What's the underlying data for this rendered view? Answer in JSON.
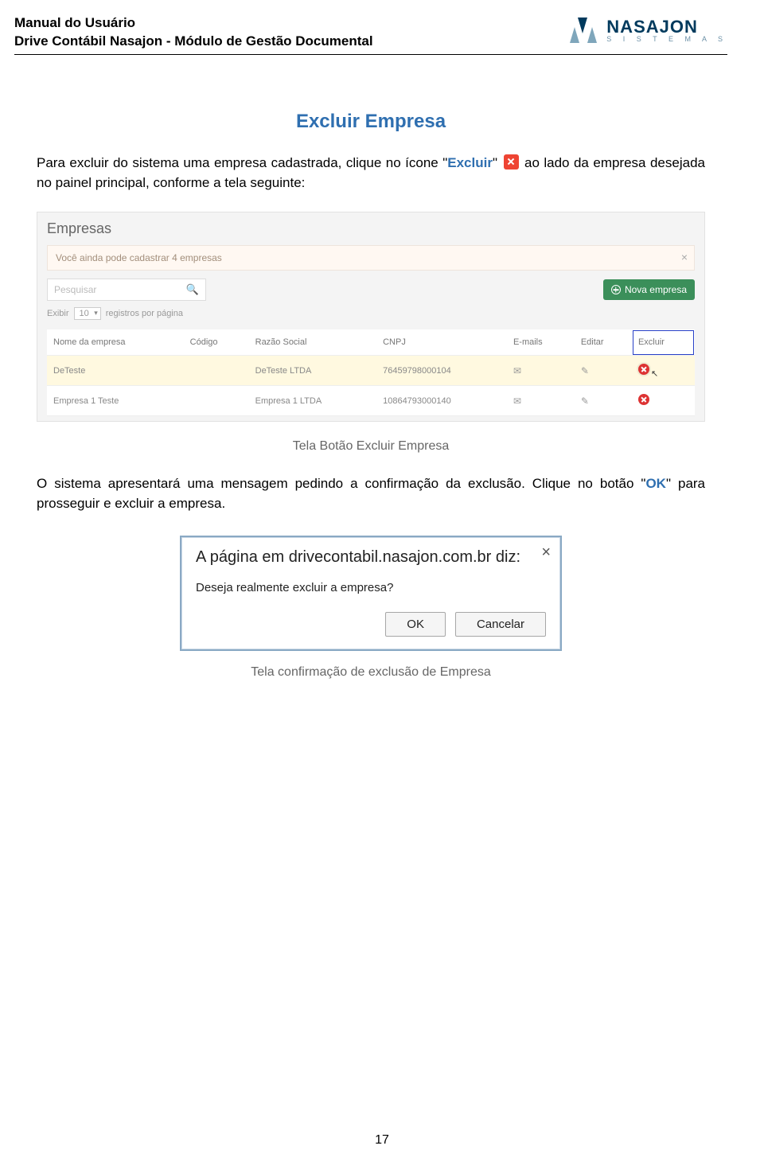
{
  "header": {
    "line1": "Manual do Usuário",
    "line2": "Drive Contábil Nasajon - Módulo de Gestão Documental",
    "logo_brand": "NASAJON",
    "logo_sub": "S I S T E M A S"
  },
  "section_title": "Excluir Empresa",
  "paragraph1": {
    "before": "Para excluir do sistema uma empresa cadastrada, clique no ícone ",
    "quote_open": "\"",
    "excluir_word": "Excluir",
    "quote_close": "\"",
    "after": "ao lado da empresa desejada no painel principal, conforme a tela seguinte:"
  },
  "panel": {
    "title": "Empresas",
    "alert": "Você ainda pode cadastrar 4 empresas",
    "search_placeholder": "Pesquisar",
    "btn_new": "Nova empresa",
    "pager_prefix": "Exibir",
    "pager_value": "10",
    "pager_suffix": "registros por página",
    "columns": [
      "Nome da empresa",
      "Código",
      "Razão Social",
      "CNPJ",
      "E-mails",
      "Editar",
      "Excluir"
    ],
    "rows": [
      {
        "nome": "DeTeste",
        "codigo": "",
        "razao": "DeTeste LTDA",
        "cnpj": "76459798000104"
      },
      {
        "nome": "Empresa 1 Teste",
        "codigo": "",
        "razao": "Empresa 1 LTDA",
        "cnpj": "10864793000140"
      }
    ]
  },
  "caption1": "Tela Botão Excluir Empresa",
  "paragraph2": {
    "line1": "O sistema apresentará uma mensagem pedindo a confirmação da exclusão. Clique no botão ",
    "ok_quote_open": "\"",
    "ok_word": "OK",
    "ok_quote_close": "\"",
    "line2": " para prosseguir e excluir a empresa."
  },
  "dialog": {
    "title": "A página em drivecontabil.nasajon.com.br diz:",
    "message": "Deseja realmente excluir a empresa?",
    "ok": "OK",
    "cancel": "Cancelar"
  },
  "caption2": "Tela confirmação de exclusão de Empresa",
  "page_number": "17"
}
